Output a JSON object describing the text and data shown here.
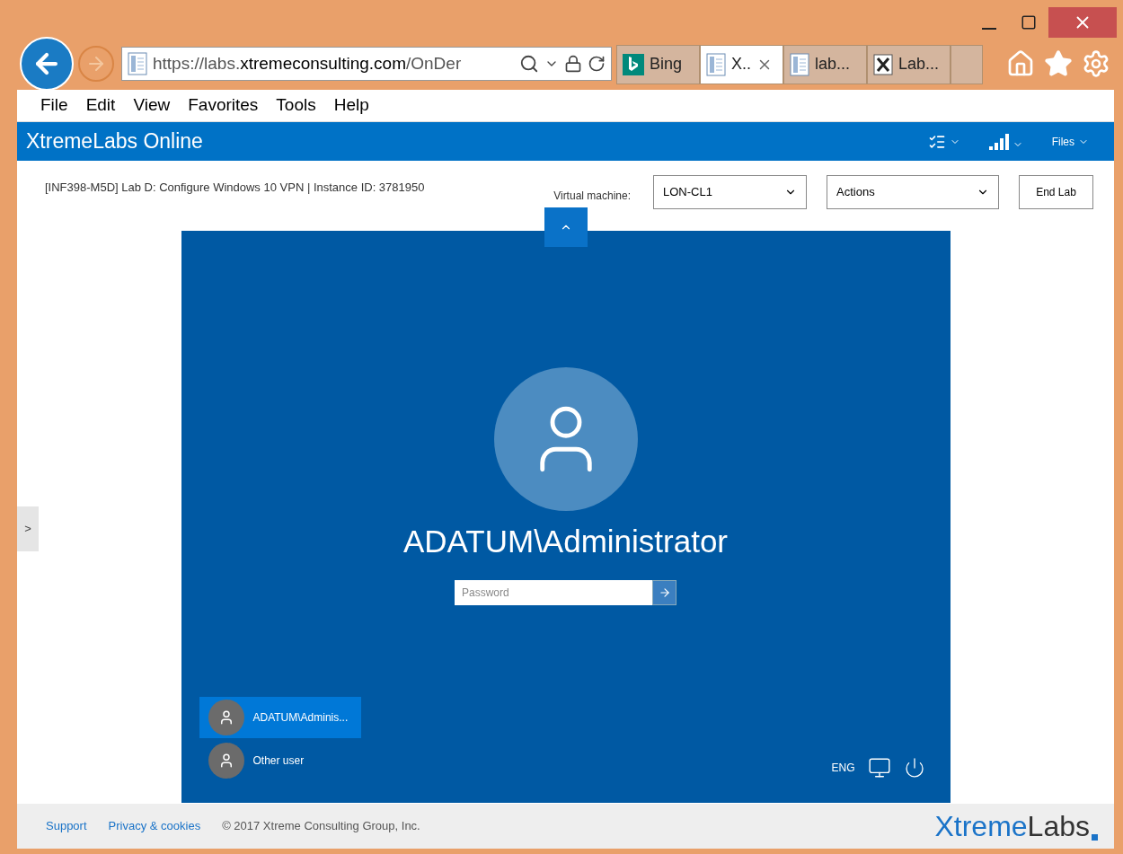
{
  "browser": {
    "address": {
      "scheme": "https://",
      "subdomain": "labs.",
      "domain": "xtremeconsulting.com",
      "path": "/OnDer"
    },
    "tabs": [
      {
        "kind": "bing",
        "label": "Bing",
        "selected": false
      },
      {
        "kind": "page",
        "label": "X..",
        "selected": true
      },
      {
        "kind": "page",
        "label": "lab...",
        "selected": false
      },
      {
        "kind": "x",
        "label": "Lab...",
        "selected": false
      }
    ],
    "menu": [
      "File",
      "Edit",
      "View",
      "Favorites",
      "Tools",
      "Help"
    ]
  },
  "app": {
    "title": "XtremeLabs Online",
    "header_actions": [
      {
        "kind": "tasks"
      },
      {
        "kind": "signal"
      },
      {
        "kind": "text",
        "label": "Files"
      }
    ],
    "lab_title": "[INF398-M5D] Lab D: Configure Windows 10 VPN | Instance ID: 3781950",
    "vm_label": "Virtual machine:",
    "vm_value": "LON-CL1",
    "actions_value": "Actions",
    "end_button": "End Lab",
    "side_toggle": ">"
  },
  "lock_screen": {
    "user_name": "ADATUM\\Administrator",
    "password_placeholder": "Password",
    "users": [
      {
        "name": "ADATUM\\Adminis...",
        "selected": true
      },
      {
        "name": "Other user",
        "selected": false
      }
    ],
    "language": "ENG"
  },
  "footer": {
    "links": [
      "Support",
      "Privacy & cookies"
    ],
    "copyright": "© 2017 Xtreme Consulting Group, Inc.",
    "logo_part1": "Xtreme",
    "logo_part2": "Labs"
  }
}
